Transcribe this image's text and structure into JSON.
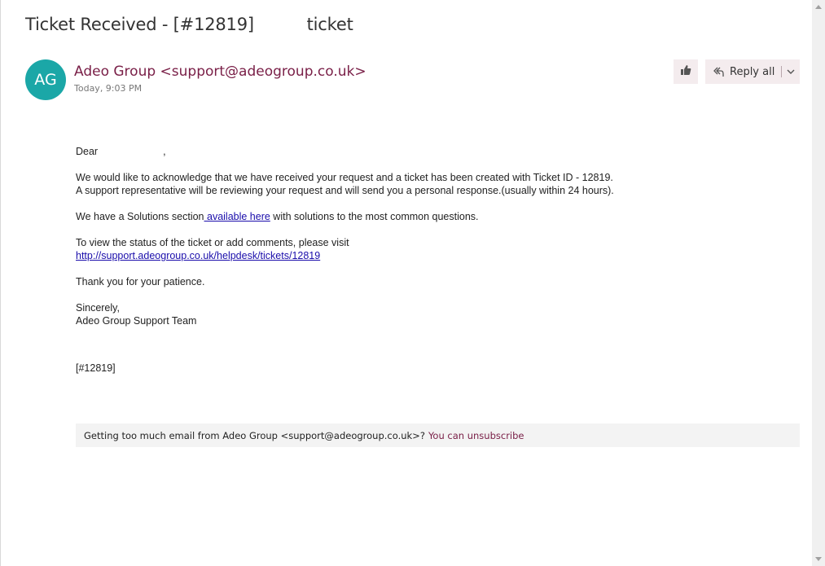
{
  "email": {
    "subject": "Ticket Received - [#12819]          ticket",
    "avatar_initials": "AG",
    "sender": "Adeo Group <support@adeogroup.co.uk>",
    "sent_time": "Today, 9:03 PM"
  },
  "actions": {
    "like_icon": "thumbs-up-icon",
    "reply_icon": "reply-all-icon",
    "reply_all_label": "Reply all",
    "more_icon": "chevron-down-icon"
  },
  "body": {
    "greeting": "Dear",
    "greeting_comma": ",",
    "para1_line1": "We would like to acknowledge that we have received your request and a ticket has been created with Ticket ID - 12819.",
    "para1_line2": "A support representative will be reviewing your request and will send you a personal response.(usually within 24 hours).",
    "solutions_prefix": "We have a Solutions section",
    "solutions_link": " available here",
    "solutions_suffix": " with solutions to the most common questions.",
    "status_text": "To view the status of the ticket or add comments, please visit",
    "status_link": "http://support.adeogroup.co.uk/helpdesk/tickets/12819",
    "thanks": "Thank you for your patience.",
    "closing": "Sincerely,",
    "signature": "Adeo Group Support Team",
    "ticket_ref": "[#12819]"
  },
  "footer": {
    "text": "Getting too much email from Adeo Group <support@adeogroup.co.uk>?",
    "unsubscribe_label": "You can unsubscribe"
  },
  "colors": {
    "avatar_bg": "#1ba7a7",
    "sender": "#7a2048",
    "button_bg": "#f4ecee",
    "link": "#1a0dab"
  }
}
